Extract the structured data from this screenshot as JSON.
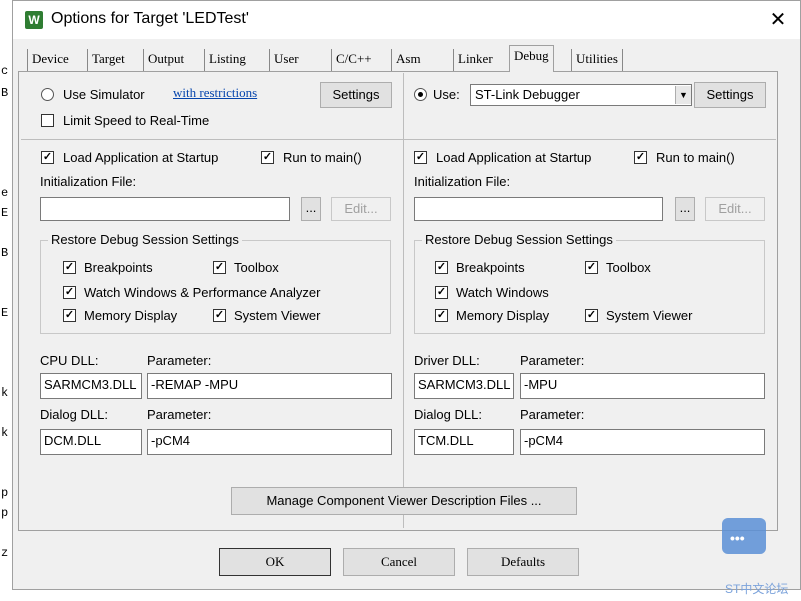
{
  "editor": {
    "chars": [
      "c",
      "B",
      "e",
      "E",
      "B",
      "E",
      "k",
      "k",
      "p",
      "p",
      "z"
    ]
  },
  "window": {
    "title": "Options for Target 'LEDTest'",
    "close": "✕",
    "icon": "W"
  },
  "tabs": [
    "Device",
    "Target",
    "Output",
    "Listing",
    "User",
    "C/C++",
    "Asm",
    "Linker",
    "Debug",
    "Utilities"
  ],
  "left": {
    "use_simulator": "Use Simulator",
    "with_restrictions": "with restrictions",
    "settings": "Settings",
    "limit_speed": "Limit Speed to Real-Time",
    "load_app": "Load Application at Startup",
    "run_to_main": "Run to main()",
    "init_file": "Initialization File:",
    "browse": "...",
    "edit": "Edit...",
    "restore_group": "Restore Debug Session Settings",
    "breakpoints": "Breakpoints",
    "toolbox": "Toolbox",
    "watch": "Watch Windows & Performance Analyzer",
    "memory": "Memory Display",
    "system_viewer": "System Viewer",
    "cpu_dll_label": "CPU DLL:",
    "param_label": "Parameter:",
    "cpu_dll": "SARMCM3.DLL",
    "cpu_param": "-REMAP -MPU",
    "dialog_dll_label": "Dialog DLL:",
    "dialog_dll": "DCM.DLL",
    "dialog_param": "-pCM4"
  },
  "right": {
    "use": "Use:",
    "debugger": "ST-Link Debugger",
    "settings": "Settings",
    "load_app": "Load Application at Startup",
    "run_to_main": "Run to main()",
    "init_file": "Initialization File:",
    "browse": "...",
    "edit": "Edit...",
    "restore_group": "Restore Debug Session Settings",
    "breakpoints": "Breakpoints",
    "toolbox": "Toolbox",
    "watch": "Watch Windows",
    "memory": "Memory Display",
    "system_viewer": "System Viewer",
    "driver_dll_label": "Driver DLL:",
    "param_label": "Parameter:",
    "driver_dll": "SARMCM3.DLL",
    "driver_param": "-MPU",
    "dialog_dll_label": "Dialog DLL:",
    "dialog_dll": "TCM.DLL",
    "dialog_param": "-pCM4"
  },
  "manage_btn": "Manage Component Viewer Description Files ...",
  "footer": {
    "ok": "OK",
    "cancel": "Cancel",
    "defaults": "Defaults"
  },
  "check": "✓",
  "watermark": {
    "dots": "•••",
    "text": "ST中文论坛"
  }
}
